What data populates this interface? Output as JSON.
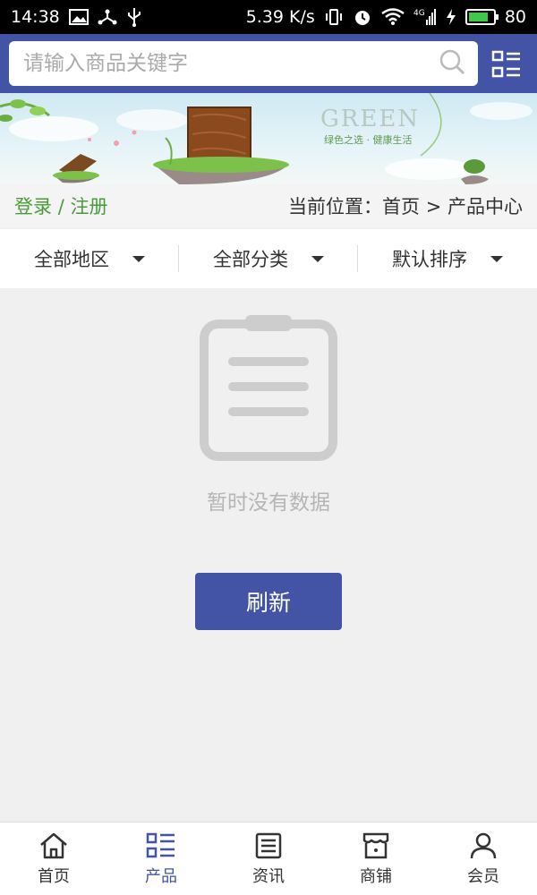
{
  "status_bar": {
    "time": "14:38",
    "speed": "5.39 K/s",
    "network": "4G",
    "battery": "80",
    "battery_level": 0.8,
    "icons": [
      "image-icon",
      "share-icon",
      "usb-icon",
      "vibrate-icon",
      "alarm-icon",
      "wifi-icon",
      "signal-icon",
      "charging-icon",
      "battery-icon"
    ]
  },
  "header": {
    "search_placeholder": "请输入商品关键字",
    "search_icon": "search-icon",
    "menu_icon": "grid-list-icon"
  },
  "banner": {
    "title_en": "GREEN",
    "subtitle_cn": "绿色之选 · 健康生活"
  },
  "nav": {
    "login": "登录",
    "separator": "/",
    "register": "注册",
    "breadcrumb": "当前位置：首页 > 产品中心"
  },
  "filters": [
    {
      "label": "全部地区"
    },
    {
      "label": "全部分类"
    },
    {
      "label": "默认排序"
    }
  ],
  "empty_state": {
    "message": "暂时没有数据",
    "refresh_label": "刷新",
    "icon": "clipboard-icon"
  },
  "tabbar": {
    "active_index": 1,
    "tabs": [
      {
        "label": "首页",
        "icon": "home-icon"
      },
      {
        "label": "产品",
        "icon": "list-icon"
      },
      {
        "label": "资讯",
        "icon": "news-icon"
      },
      {
        "label": "商铺",
        "icon": "store-icon"
      },
      {
        "label": "会员",
        "icon": "user-icon"
      }
    ]
  },
  "colors": {
    "brand": "#4354a6",
    "login_green": "#4a9b3a",
    "empty_gray": "#cdcdcd"
  }
}
